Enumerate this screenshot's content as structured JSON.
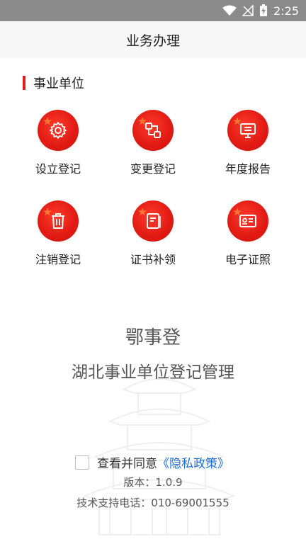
{
  "status_bar": {
    "time": "2:25",
    "icons": [
      "wifi-icon",
      "signal-icon",
      "battery-charging-icon"
    ]
  },
  "header": {
    "title": "业务办理"
  },
  "section": {
    "title": "事业单位"
  },
  "items": [
    {
      "label": "设立登记",
      "icon": "gear-icon"
    },
    {
      "label": "变更登记",
      "icon": "change-icon"
    },
    {
      "label": "年度报告",
      "icon": "report-icon"
    },
    {
      "label": "注销登记",
      "icon": "trash-icon"
    },
    {
      "label": "证书补领",
      "icon": "certificate-icon"
    },
    {
      "label": "电子证照",
      "icon": "id-card-icon"
    }
  ],
  "branding": {
    "app_name": "鄂事登",
    "subtitle": "湖北事业单位登记管理"
  },
  "footer": {
    "consent_text": "查看并同意",
    "privacy_link": "《隐私政策》",
    "version": "版本：1.0.9",
    "support": "技术支持电话：010-69001555"
  },
  "colors": {
    "accent": "#e21d1d",
    "link": "#1e6fd8"
  }
}
